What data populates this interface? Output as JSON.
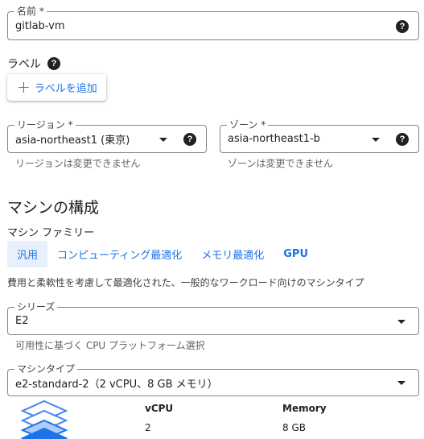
{
  "name_field": {
    "label": "名前 *",
    "value": "gitlab-vm"
  },
  "labels": {
    "title": "ラベル",
    "add_button": "ラベルを追加"
  },
  "region_field": {
    "label": "リージョン *",
    "value": "asia-northeast1 (東京)",
    "hint": "リージョンは変更できません"
  },
  "zone_field": {
    "label": "ゾーン *",
    "value": "asia-northeast1-b",
    "hint": "ゾーンは変更できません"
  },
  "machine_config": {
    "title": "マシンの構成",
    "family_label": "マシン ファミリー",
    "tabs": [
      {
        "label": "汎用",
        "active": true
      },
      {
        "label": "コンピューティング最適化",
        "active": false
      },
      {
        "label": "メモリ最適化",
        "active": false
      },
      {
        "label": "GPU",
        "active": false
      }
    ],
    "family_description": "費用と柔軟性を考慮して最適化された、一般的なワークロード向けのマシンタイプ"
  },
  "series_field": {
    "label": "シリーズ",
    "value": "E2",
    "hint": "可用性に基づく CPU プラットフォーム選択"
  },
  "machine_type_field": {
    "label": "マシンタイプ",
    "value": "e2-standard-2（2 vCPU、8 GB メモリ）"
  },
  "specs": {
    "vcpu_header": "vCPU",
    "vcpu_value": "2",
    "memory_header": "Memory",
    "memory_value": "8 GB"
  },
  "icons": {
    "help": "help-circle-icon",
    "dropdown": "arrow-drop-down-icon",
    "add": "plus-icon",
    "machine": "stacked-layers-icon"
  },
  "colors": {
    "accent": "#1a73e8",
    "tab_active_bg": "#e8f0fe",
    "border": "#80868b"
  }
}
